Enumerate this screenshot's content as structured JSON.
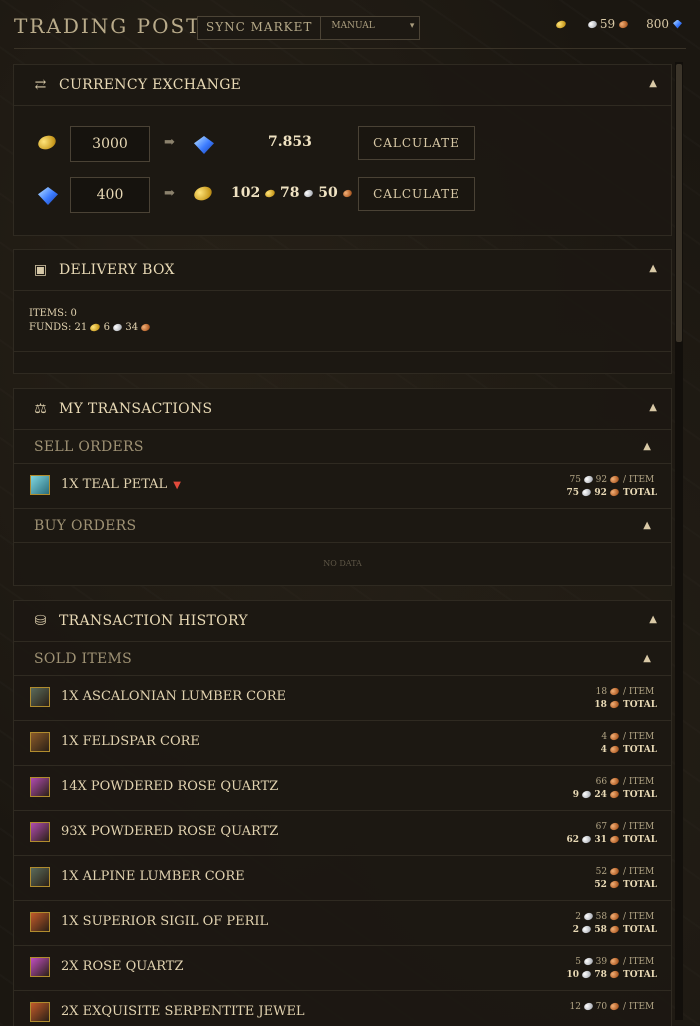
{
  "header": {
    "title": "TRADING POST",
    "sync_label": "SYNC MARKET",
    "mode": "MANUAL",
    "wallet": {
      "silver": "59",
      "gems": "800"
    }
  },
  "exchange": {
    "title": "CURRENCY EXCHANGE",
    "row1": {
      "input": "3000",
      "result": "7.853",
      "button": "CALCULATE"
    },
    "row2": {
      "input": "400",
      "gold": "102",
      "silver": "78",
      "copper": "50",
      "button": "CALCULATE"
    }
  },
  "delivery": {
    "title": "DELIVERY BOX",
    "items_text": "ITEMS: 0",
    "funds_label": "FUNDS:",
    "funds": {
      "gold": "21",
      "silver": "6",
      "copper": "34"
    }
  },
  "transactions": {
    "title": "MY TRANSACTIONS",
    "sell_label": "SELL ORDERS",
    "buy_label": "BUY ORDERS",
    "no_data": "NO DATA",
    "sell_items": [
      {
        "name": "1X TEAL PETAL",
        "unit_s": "75",
        "unit_c": "92",
        "total_s": "75",
        "total_c": "92"
      }
    ]
  },
  "history": {
    "title": "TRANSACTION HISTORY",
    "sold_label": "SOLD ITEMS",
    "per_item": "/ ITEM",
    "total": "TOTAL",
    "items": [
      {
        "name": "1X ASCALONIAN LUMBER CORE",
        "unit_c": "18",
        "total_c": "18",
        "icon_color": "#5a6b5c"
      },
      {
        "name": "1X FELDSPAR CORE",
        "unit_c": "4",
        "total_c": "4",
        "icon_color": "#8a5a2a"
      },
      {
        "name": "14X POWDERED ROSE QUARTZ",
        "unit_c": "66",
        "total_s": "9",
        "total_c": "24",
        "icon_color": "#b04cb0"
      },
      {
        "name": "93X POWDERED ROSE QUARTZ",
        "unit_c": "67",
        "total_s": "62",
        "total_c": "31",
        "icon_color": "#b04cb0"
      },
      {
        "name": "1X ALPINE LUMBER CORE",
        "unit_c": "52",
        "total_c": "52",
        "icon_color": "#5a6b5c"
      },
      {
        "name": "1X SUPERIOR SIGIL OF PERIL",
        "unit_s": "2",
        "unit_c": "58",
        "total_s": "2",
        "total_c": "58",
        "icon_color": "#c25a2a"
      },
      {
        "name": "2X ROSE QUARTZ",
        "unit_s": "5",
        "unit_c": "39",
        "total_s": "10",
        "total_c": "78",
        "icon_color": "#c04fc0"
      },
      {
        "name": "2X EXQUISITE SERPENTITE JEWEL",
        "unit_s": "12",
        "unit_c": "70",
        "icon_color": "#c25a2a"
      }
    ]
  }
}
